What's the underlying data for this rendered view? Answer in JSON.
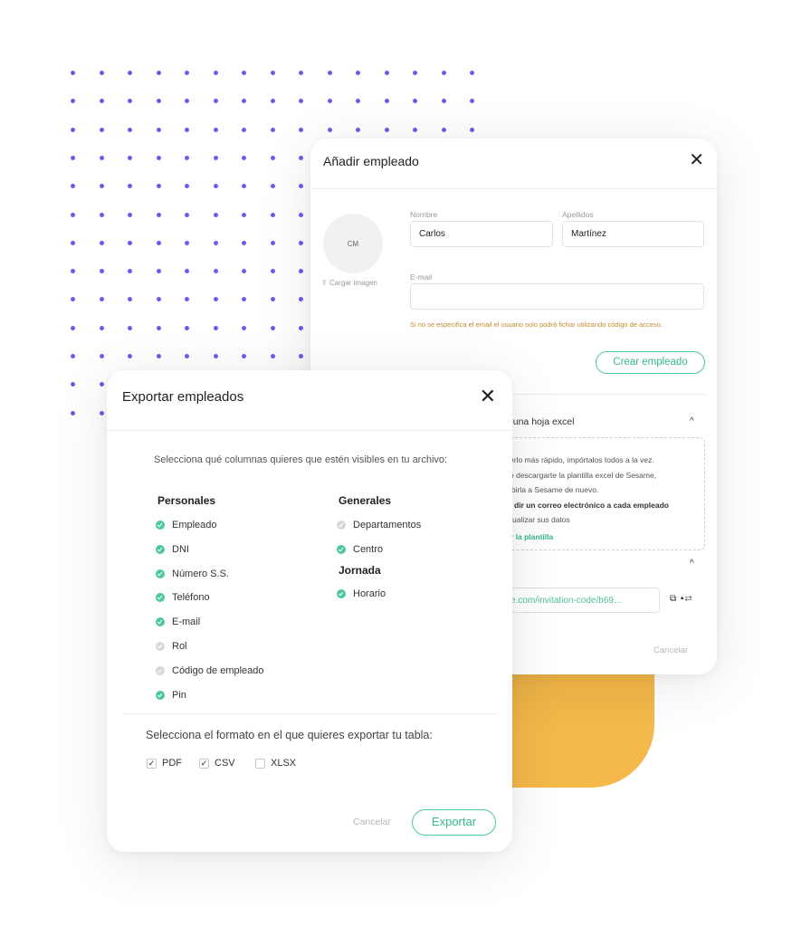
{
  "colors": {
    "accent": "#4fc7a0",
    "dots": "#6b5cf0",
    "warning": "#c88a2a",
    "decor_yellow": "#f5b84a"
  },
  "add_employee": {
    "title": "Añadir empleado",
    "avatar_initials": "CM",
    "upload_label": "Cargar imagen",
    "nombre_label": "Nombre",
    "nombre_value": "Carlos",
    "apellidos_label": "Apellidos",
    "apellidos_value": "Martínez",
    "email_label": "E-mail",
    "email_value": "",
    "warning": "Si no se especifica el email el usuario solo podrá fichar utilizando código de acceso.",
    "create_button": "Crear empleado",
    "import_title": "e una hoja excel",
    "import_lines": [
      "erlo más rápido, impórtalos todos a la vez.",
      "e descargarte la plantilla excel de Sesame,",
      "ibirla a Sesame de nuevo."
    ],
    "import_bold": "dir un correo electrónico a cada empleado",
    "import_line4": "ualizar sus datos",
    "import_link": "r la plantilla",
    "invite_url": "e.com/invitation-code/b69...",
    "cancel": "Cancelar"
  },
  "export": {
    "title": "Exportar empleados",
    "instructions": "Selecciona qué columnas quieres que estén visibles en tu archivo:",
    "personales_title": "Personales",
    "personales": [
      {
        "label": "Empleado",
        "checked": true
      },
      {
        "label": "DNI",
        "checked": true
      },
      {
        "label": "Número S.S.",
        "checked": true
      },
      {
        "label": "Teléfono",
        "checked": true
      },
      {
        "label": "E-mail",
        "checked": true
      },
      {
        "label": "Rol",
        "checked": false
      },
      {
        "label": "Código de empleado",
        "checked": false
      },
      {
        "label": "Pin",
        "checked": true
      }
    ],
    "generales_title": "Generales",
    "generales": [
      {
        "label": "Departamentos",
        "checked": false
      },
      {
        "label": "Centro",
        "checked": true
      }
    ],
    "jornada_title": "Jornada",
    "jornada": [
      {
        "label": "Horario",
        "checked": true
      }
    ],
    "format_question": "Selecciona el formato en el que quieres exportar tu tabla:",
    "formats": [
      {
        "label": "PDF",
        "checked": true
      },
      {
        "label": "CSV",
        "checked": true
      },
      {
        "label": "XLSX",
        "checked": false
      }
    ],
    "cancel": "Cancelar",
    "export_button": "Exportar"
  }
}
